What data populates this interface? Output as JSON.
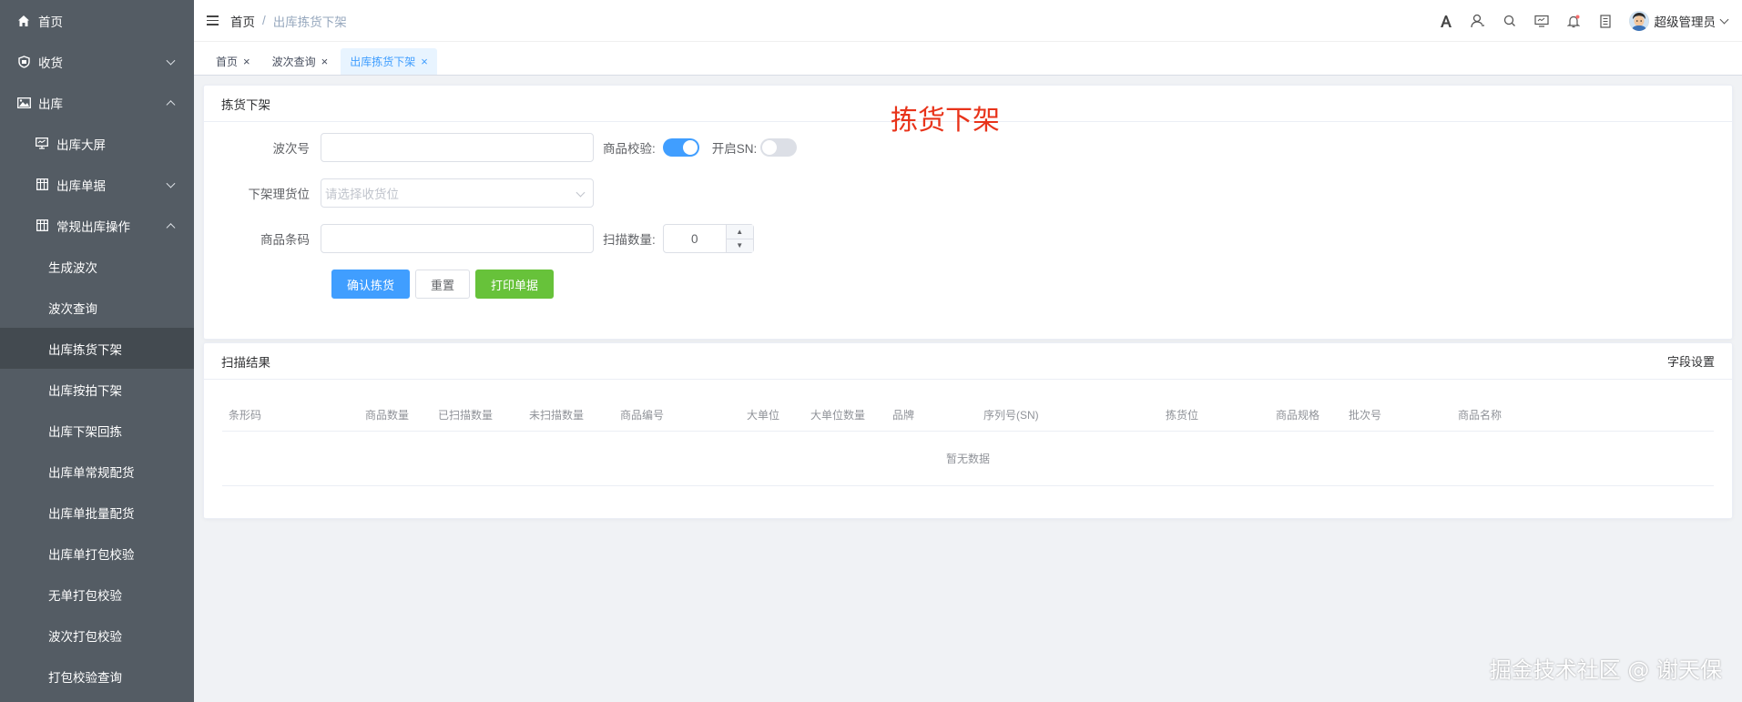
{
  "sidebar": {
    "items": [
      {
        "label": "首页",
        "icon": "home-icon",
        "level": 1
      },
      {
        "label": "收货",
        "icon": "shield-icon",
        "level": 1,
        "expanded": false
      },
      {
        "label": "出库",
        "icon": "picture-icon",
        "level": 1,
        "expanded": true
      },
      {
        "label": "出库大屏",
        "icon": "monitor-icon",
        "level": 2
      },
      {
        "label": "出库单据",
        "icon": "table-icon",
        "level": 2,
        "expanded": false
      },
      {
        "label": "常规出库操作",
        "icon": "table-icon",
        "level": 2,
        "expanded": true
      },
      {
        "label": "生成波次",
        "level": 3
      },
      {
        "label": "波次查询",
        "level": 3
      },
      {
        "label": "出库拣货下架",
        "level": 3,
        "active": true
      },
      {
        "label": "出库按拍下架",
        "level": 3
      },
      {
        "label": "出库下架回拣",
        "level": 3
      },
      {
        "label": "出库单常规配货",
        "level": 3
      },
      {
        "label": "出库单批量配货",
        "level": 3
      },
      {
        "label": "出库单打包校验",
        "level": 3
      },
      {
        "label": "无单打包校验",
        "level": 3
      },
      {
        "label": "波次打包校验",
        "level": 3
      },
      {
        "label": "打包校验查询",
        "level": 3
      }
    ]
  },
  "header": {
    "breadcrumb": [
      "首页",
      "出库拣货下架"
    ],
    "breadcrumb_sep": "/",
    "username": "超级管理员"
  },
  "tags": [
    {
      "label": "首页",
      "active": false
    },
    {
      "label": "波次查询",
      "active": false
    },
    {
      "label": "出库拣货下架",
      "active": true
    }
  ],
  "form_card": {
    "title": "拣货下架",
    "big_title": "拣货下架",
    "wave_no": {
      "label": "波次号",
      "value": ""
    },
    "goods_check": {
      "label": "商品校验:",
      "on": true
    },
    "sn_switch": {
      "label": "开启SN:",
      "on": false
    },
    "location": {
      "label": "下架理货位",
      "placeholder": "请选择收货位"
    },
    "barcode": {
      "label": "商品条码",
      "value": ""
    },
    "scan_qty": {
      "label": "扫描数量:",
      "value": "0"
    },
    "buttons": {
      "confirm": "确认拣货",
      "reset": "重置",
      "print": "打印单据"
    }
  },
  "result_card": {
    "title": "扫描结果",
    "settings": "字段设置",
    "columns": [
      "条形码",
      "商品数量",
      "已扫描数量",
      "未扫描数量",
      "商品编号",
      "大单位",
      "大单位数量",
      "品牌",
      "序列号(SN)",
      "拣货位",
      "商品规格",
      "批次号",
      "商品名称"
    ],
    "empty_text": "暂无数据"
  },
  "watermark": "掘金技术社区 @ 谢天保",
  "colors": {
    "sidebar": "#545c64",
    "primary": "#409eff",
    "success": "#67c23a",
    "title_red": "#e8331a"
  }
}
